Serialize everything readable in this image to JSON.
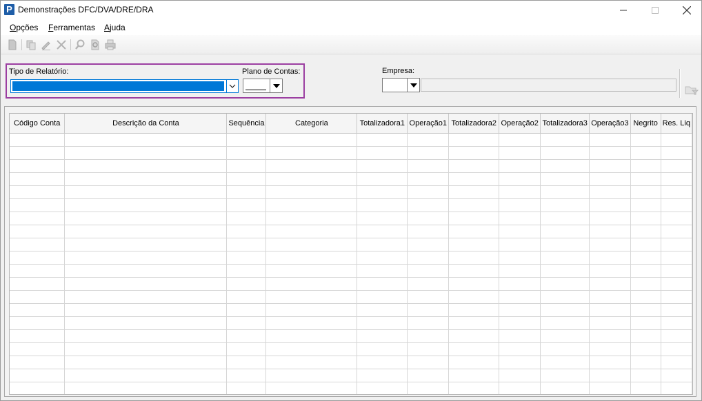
{
  "window": {
    "title": "Demonstrações DFC/DVA/DRE/DRA",
    "app_icon_letter": "P"
  },
  "menu": {
    "items": [
      {
        "accel": "O",
        "rest": "pções"
      },
      {
        "accel": "F",
        "rest": "erramentas"
      },
      {
        "accel": "A",
        "rest": "juda"
      }
    ]
  },
  "toolbar": {
    "icons": [
      "new-document-icon",
      "copy-icon",
      "edit-icon",
      "delete-icon",
      "search-icon",
      "preview-icon",
      "print-icon"
    ]
  },
  "filters": {
    "tipo_label": "Tipo de Relatório:",
    "tipo_value": "",
    "plano_label": "Plano de Contas:",
    "plano_value": "",
    "empresa_label": "Empresa:",
    "empresa_value": "",
    "empresa_name": ""
  },
  "grid": {
    "columns": [
      "Código Conta",
      "Descrição da Conta",
      "Sequência",
      "Categoria",
      "Totalizadora1",
      "Operação1",
      "Totalizadora2",
      "Operação2",
      "Totalizadora3",
      "Operação3",
      "Negrito",
      "Res. Liq"
    ],
    "rows": []
  },
  "colors": {
    "highlight_border": "#9b3ea1",
    "selection_blue": "#0078d7"
  }
}
